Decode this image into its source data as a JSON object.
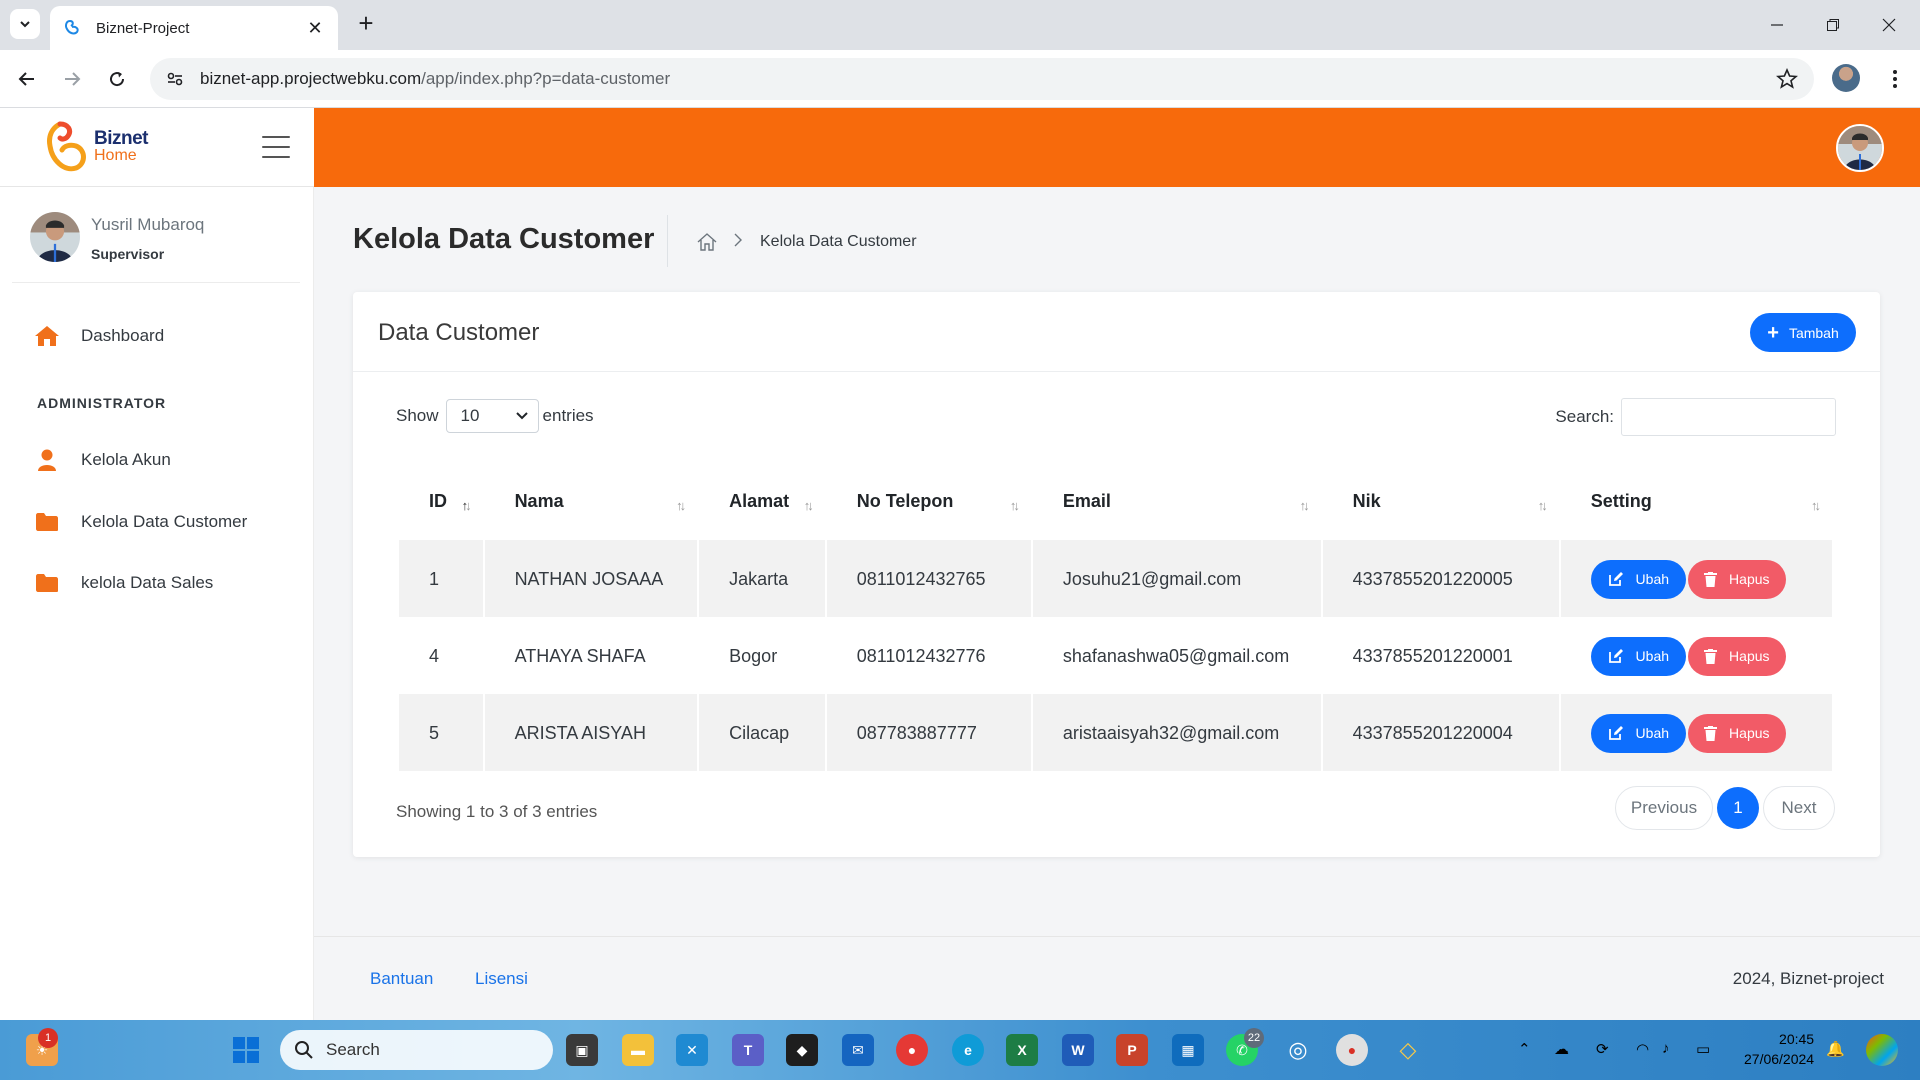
{
  "browser": {
    "tab_title": "Biznet-Project",
    "url_main": "biznet-app.projectwebku.com",
    "url_path": "/app/index.php?p=data-customer"
  },
  "logo": {
    "line1": "Biznet",
    "line2": "Home"
  },
  "user": {
    "name": "Yusril Mubaroq",
    "role": "Supervisor"
  },
  "sidebar": {
    "dashboard": "Dashboard",
    "section": "ADMINISTRATOR",
    "items": [
      "Kelola Akun",
      "Kelola Data Customer",
      "kelola Data Sales"
    ]
  },
  "page": {
    "title": "Kelola Data Customer",
    "breadcrumb_current": "Kelola Data Customer"
  },
  "card": {
    "title": "Data Customer",
    "add_label": "Tambah",
    "show_label": "Show",
    "show_value": "10",
    "entries_label": "entries",
    "search_label": "Search:"
  },
  "table": {
    "columns": [
      "ID",
      "Nama",
      "Alamat",
      "No Telepon",
      "Email",
      "Nik",
      "Setting"
    ],
    "rows": [
      {
        "id": "1",
        "nama": "NATHAN JOSAAA",
        "alamat": "Jakarta",
        "telp": "0811012432765",
        "email": "Josuhu21@gmail.com",
        "nik": "4337855201220005"
      },
      {
        "id": "4",
        "nama": "ATHAYA SHAFA",
        "alamat": "Bogor",
        "telp": "0811012432776",
        "email": "shafanashwa05@gmail.com",
        "nik": "4337855201220001"
      },
      {
        "id": "5",
        "nama": "ARISTA AISYAH",
        "alamat": "Cilacap",
        "telp": "087783887777",
        "email": "aristaaisyah32@gmail.com",
        "nik": "4337855201220004"
      }
    ],
    "edit_label": "Ubah",
    "delete_label": "Hapus"
  },
  "pagination": {
    "info": "Showing 1 to 3 of 3 entries",
    "previous": "Previous",
    "current": "1",
    "next": "Next"
  },
  "footer": {
    "help": "Bantuan",
    "license": "Lisensi",
    "copyright": "2024, Biznet-project"
  },
  "taskbar": {
    "search_placeholder": "Search",
    "time": "20:45",
    "date": "27/06/2024",
    "notif_badge": "1",
    "whatsapp_badge": "22"
  },
  "colors": {
    "accent_orange": "#f76a0c",
    "primary_blue": "#0d6efd",
    "danger": "#f25b67"
  }
}
